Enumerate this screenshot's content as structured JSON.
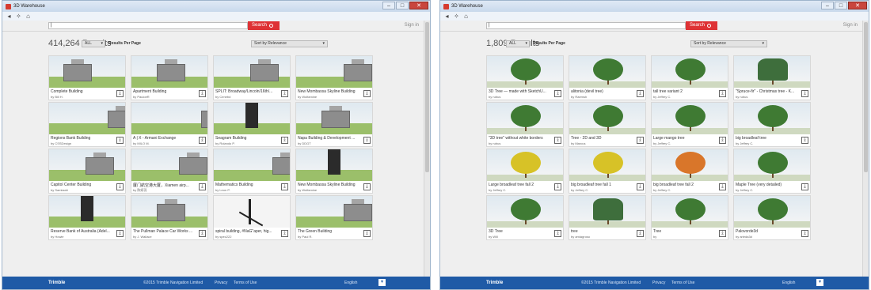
{
  "windows": [
    {
      "title": "3D Warehouse",
      "search_button": "Search",
      "signin": "Sign in",
      "results_count": "414,264 Results",
      "rpp_value": "ALL",
      "rpp_label": "Results Per Page",
      "sort_value": "Sort by Relevance",
      "cards": [
        {
          "title": "Complete Building",
          "author": "by Bill H.",
          "thumb": "building"
        },
        {
          "title": "Apartment Building",
          "author": "by PauloeR",
          "thumb": "building"
        },
        {
          "title": "SPLIT: Broadway/Lincoln/16th/...",
          "author": "by Cenebd",
          "thumb": "building"
        },
        {
          "title": "New Mombassa Skyline Building",
          "author": "by Wolfamine",
          "thumb": "building"
        },
        {
          "title": "Regions Bank Building",
          "author": "by CSSDesign",
          "thumb": "building"
        },
        {
          "title": "A | X - Armani Exchange",
          "author": "by MILO M.",
          "thumb": "building"
        },
        {
          "title": "Seagram Building",
          "author": "by Rolando P.",
          "thumb": "tower"
        },
        {
          "title": "Napa Building & Development ...",
          "author": "by DDGT",
          "thumb": "building"
        },
        {
          "title": "Capitol Center Building",
          "author": "by Samlauki",
          "thumb": "building"
        },
        {
          "title": "厦门航空港大厦，Xiamen airp...",
          "author": "by 陈妍羽",
          "thumb": "building"
        },
        {
          "title": "Mathematics Building",
          "author": "by Leon P.",
          "thumb": "building"
        },
        {
          "title": "New Mombassa Skyline Building",
          "author": "by Wolfamine",
          "thumb": "tower"
        },
        {
          "title": "Reserve Bank of Australia (Adel...",
          "author": "by Howie",
          "thumb": "tower"
        },
        {
          "title": "The Pullman Palace Car Works ...",
          "author": "by J. Wallace",
          "thumb": "building"
        },
        {
          "title": "spiral building, #NaG\"aper, hig...",
          "author": "by spec222",
          "thumb": "spiral"
        },
        {
          "title": "The Green Building",
          "author": "by Paul R.",
          "thumb": "building"
        }
      ],
      "footer": {
        "brand": "Trimble",
        "copyright": "©2015 Trimble Navigation Limited",
        "privacy": "Privacy",
        "terms": "Terms of Use",
        "language": "English"
      }
    },
    {
      "title": "3D Warehouse",
      "search_button": "Search",
      "signin": "Sign in",
      "results_count": "1,809 Results",
      "rpp_value": "ALL",
      "rpp_label": "Results Per Page",
      "sort_value": "Sort by Relevance",
      "cards": [
        {
          "title": "3D Tree — made with SketchU...",
          "author": "by rubus",
          "thumb": "tree"
        },
        {
          "title": "alitonia (devil tree)",
          "author": "by Raemsh",
          "thumb": "tree"
        },
        {
          "title": "tall tree variant 2",
          "author": "by Jeffrey C.",
          "thumb": "tree"
        },
        {
          "title": "\"Spruce-fir\" - Christmas tree - K...",
          "author": "by rubus",
          "thumb": "spruce"
        },
        {
          "title": "\"3D tree\" without white borders",
          "author": "by rubus",
          "thumb": "tree"
        },
        {
          "title": "Tree - 2D and 3D",
          "author": "by Marcus",
          "thumb": "tree"
        },
        {
          "title": "Large mango tree",
          "author": "by Jeffrey C.",
          "thumb": "tree"
        },
        {
          "title": "big broadleaf tree",
          "author": "by Jeffrey C.",
          "thumb": "tree"
        },
        {
          "title": "Large broadleaf tree fall 2",
          "author": "by Jeffrey C.",
          "thumb": "yellow"
        },
        {
          "title": "big broadleaf tree fall 1",
          "author": "by Jeffrey C.",
          "thumb": "yellow"
        },
        {
          "title": "big broadleaf tree fall 2",
          "author": "by Jeffrey C.",
          "thumb": "orange"
        },
        {
          "title": "Maple Tree (very detailed)",
          "author": "by Jeffrey C.",
          "thumb": "tree"
        },
        {
          "title": "3D Tree",
          "author": "by Will",
          "thumb": "tree"
        },
        {
          "title": "tree",
          "author": "by amiagroso",
          "thumb": "spruce"
        },
        {
          "title": "Tree",
          "author": "by",
          "thumb": "tree"
        },
        {
          "title": "Palovorde3d",
          "author": "by arieda3d",
          "thumb": "tree"
        }
      ],
      "footer": {
        "brand": "Trimble",
        "copyright": "©2015 Trimble Navigation Limited",
        "privacy": "Privacy",
        "terms": "Terms of Use",
        "language": "English"
      }
    }
  ]
}
